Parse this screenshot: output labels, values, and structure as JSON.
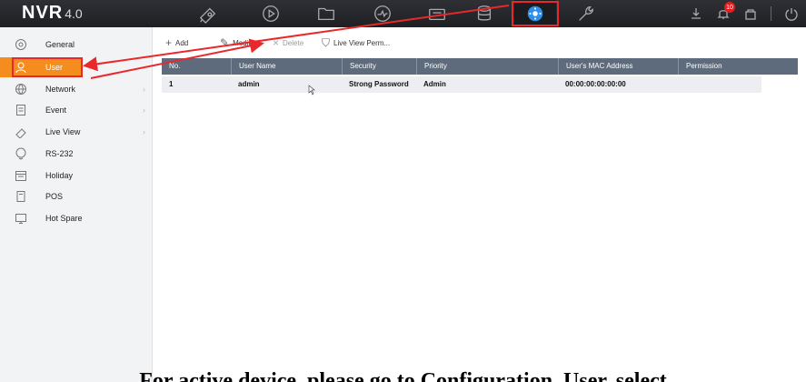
{
  "app": {
    "logo_main": "NVR",
    "logo_version": "4.0"
  },
  "topnav": {
    "icons": [
      {
        "name": "live-view-icon"
      },
      {
        "name": "playback-icon"
      },
      {
        "name": "file-management-icon"
      },
      {
        "name": "smart-analysis-icon"
      },
      {
        "name": "camera-management-icon"
      },
      {
        "name": "storage-icon"
      },
      {
        "name": "configuration-icon"
      },
      {
        "name": "maintenance-icon"
      }
    ],
    "active": "configuration-icon",
    "notification_count": "10"
  },
  "sidebar": {
    "items": [
      {
        "label": "General",
        "icon": "settings-icon",
        "has_children": false
      },
      {
        "label": "User",
        "icon": "user-icon",
        "has_children": false,
        "active": true
      },
      {
        "label": "Network",
        "icon": "globe-icon",
        "has_children": true
      },
      {
        "label": "Event",
        "icon": "event-icon",
        "has_children": true
      },
      {
        "label": "Live View",
        "icon": "camera-icon",
        "has_children": true
      },
      {
        "label": "RS-232",
        "icon": "serial-port-icon",
        "has_children": false
      },
      {
        "label": "Holiday",
        "icon": "calendar-icon",
        "has_children": false
      },
      {
        "label": "POS",
        "icon": "pos-icon",
        "has_children": false
      },
      {
        "label": "Hot Spare",
        "icon": "hot-spare-icon",
        "has_children": false
      }
    ]
  },
  "toolbar": {
    "add_label": "Add",
    "modify_label": "Modify",
    "delete_label": "Delete",
    "liveview_perm_label": "Live View Perm..."
  },
  "table": {
    "columns": [
      "No.",
      "User Name",
      "Security",
      "Priority",
      "User's MAC Address",
      "Permission"
    ],
    "rows": [
      {
        "no": "1",
        "user_name": "admin",
        "security": "Strong Password",
        "priority": "Admin",
        "mac": "00:00:00:00:00:00",
        "permission": ""
      }
    ]
  },
  "annotation": {
    "arrow_color": "#e8282b",
    "caption": "For active device, please go to Configuration, User, select"
  },
  "colors": {
    "accent": "#f48d1e",
    "topbar": "#24262a",
    "table_header": "#5d6b7c"
  }
}
